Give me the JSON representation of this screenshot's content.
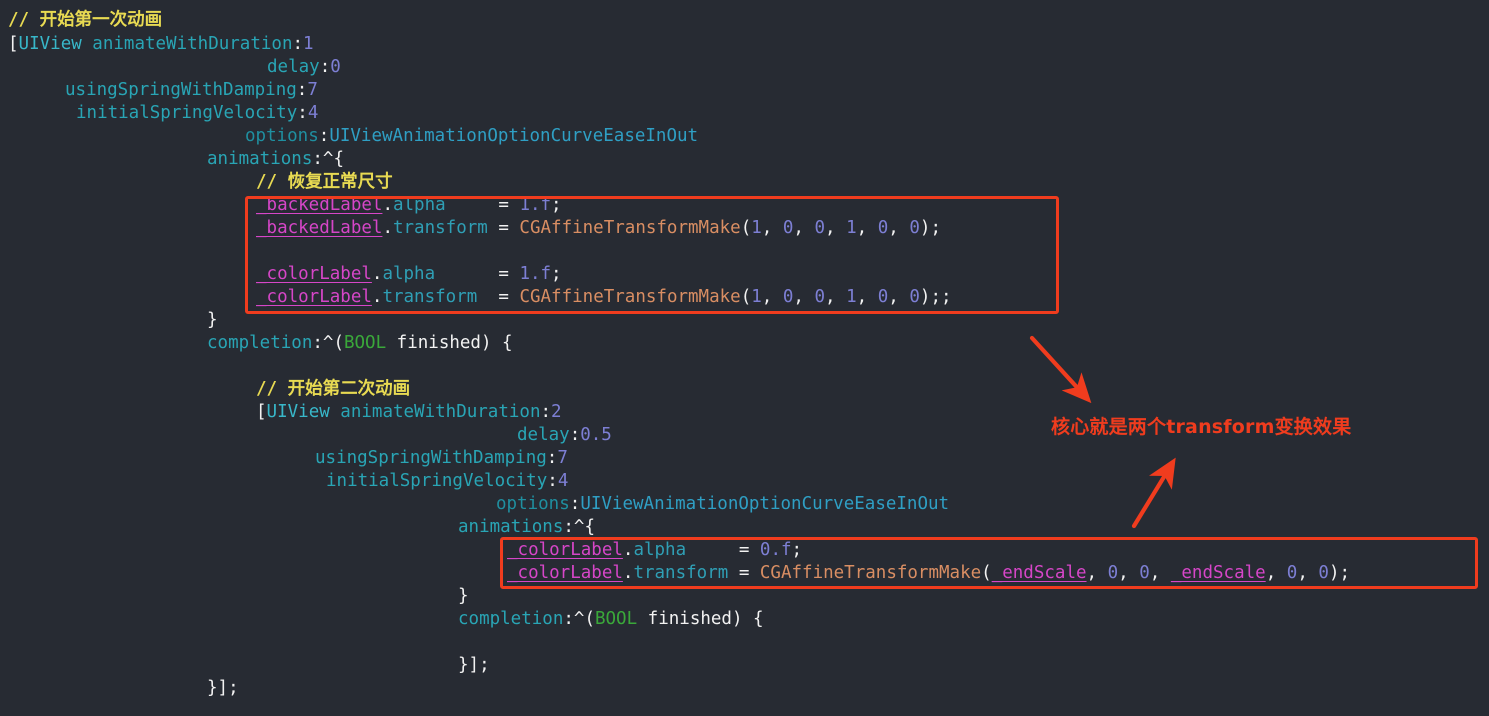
{
  "editor": {
    "background_color": "#272b33",
    "default_text_color": "#f2f2f2",
    "comment_color": "#e8da52",
    "class_color": "#38b7c9",
    "selector_color": "#29a5b5",
    "number_color": "#7d7fd4",
    "enum_color": "#2f9fc4",
    "ivar_color": "#d646c8",
    "property_color": "#2f9fb5",
    "function_color": "#d98e63",
    "type_color": "#3aa83a",
    "annotation_color": "#f03c1e",
    "language": "Objective-C"
  },
  "code": {
    "line_01_comment": "// 开始第一次动画",
    "line_02_bracket": "[",
    "line_02_class": "UIView",
    "line_02_selector": " animateWithDuration",
    "line_02_colon": ":",
    "line_02_value": "1",
    "line_03_selector": "delay",
    "line_03_colon": ":",
    "line_03_value": "0",
    "line_04_selector": "usingSpringWithDamping",
    "line_04_colon": ":",
    "line_04_value": "7",
    "line_05_selector": "initialSpringVelocity",
    "line_05_colon": ":",
    "line_05_value": "4",
    "line_06_selector": "options",
    "line_06_colon": ":",
    "line_06_value": "UIViewAnimationOptionCurveEaseInOut",
    "line_07_selector": "animations",
    "line_07_colon": ":",
    "line_07_block": "^{",
    "line_08_comment": "// 恢复正常尺寸",
    "line_09_ivar": "_backedLabel",
    "line_09_dot": ".",
    "line_09_prop": "alpha",
    "line_09_assign": "     = ",
    "line_09_value": "1.f",
    "line_09_semi": ";",
    "line_10_ivar": "_backedLabel",
    "line_10_dot": ".",
    "line_10_prop": "transform",
    "line_10_assign": " = ",
    "line_10_func": "CGAffineTransformMake",
    "line_10_args_open": "(",
    "line_10_a1": "1",
    "line_10_c1": ", ",
    "line_10_a2": "0",
    "line_10_c2": ", ",
    "line_10_a3": "0",
    "line_10_c3": ", ",
    "line_10_a4": "1",
    "line_10_c4": ", ",
    "line_10_a5": "0",
    "line_10_c5": ", ",
    "line_10_a6": "0",
    "line_10_close": ");",
    "line_12_ivar": "_colorLabel",
    "line_12_dot": ".",
    "line_12_prop": "alpha",
    "line_12_assign": "      = ",
    "line_12_value": "1.f",
    "line_12_semi": ";",
    "line_13_ivar": "_colorLabel",
    "line_13_dot": ".",
    "line_13_prop": "transform",
    "line_13_assign": "  = ",
    "line_13_func": "CGAffineTransformMake",
    "line_13_args_open": "(",
    "line_13_a1": "1",
    "line_13_c1": ", ",
    "line_13_a2": "0",
    "line_13_c2": ", ",
    "line_13_a3": "0",
    "line_13_c3": ", ",
    "line_13_a4": "1",
    "line_13_c4": ", ",
    "line_13_a5": "0",
    "line_13_c5": ", ",
    "line_13_a6": "0",
    "line_13_close": ");;",
    "line_14_brace": "}",
    "line_15_selector": "completion",
    "line_15_colon": ":",
    "line_15_block_open": "^(",
    "line_15_type": "BOOL",
    "line_15_param": " finished) {",
    "line_17_comment": "// 开始第二次动画",
    "line_18_bracket": "[",
    "line_18_class": "UIView",
    "line_18_selector": " animateWithDuration",
    "line_18_colon": ":",
    "line_18_value": "2",
    "line_19_selector": "delay",
    "line_19_colon": ":",
    "line_19_value": "0.5",
    "line_20_selector": "usingSpringWithDamping",
    "line_20_colon": ":",
    "line_20_value": "7",
    "line_21_selector": "initialSpringVelocity",
    "line_21_colon": ":",
    "line_21_value": "4",
    "line_22_selector": "options",
    "line_22_colon": ":",
    "line_22_value": "UIViewAnimationOptionCurveEaseInOut",
    "line_23_selector": "animations",
    "line_23_colon": ":",
    "line_23_block": "^{",
    "line_24_ivar": "_colorLabel",
    "line_24_dot": ".",
    "line_24_prop": "alpha",
    "line_24_assign": "     = ",
    "line_24_value": "0.f",
    "line_24_semi": ";",
    "line_25_ivar": "_colorLabel",
    "line_25_dot": ".",
    "line_25_prop": "transform",
    "line_25_assign": " = ",
    "line_25_func": "CGAffineTransformMake",
    "line_25_args_open": "(",
    "line_25_a1": "_endScale",
    "line_25_c1": ", ",
    "line_25_a2": "0",
    "line_25_c2": ", ",
    "line_25_a3": "0",
    "line_25_c3": ", ",
    "line_25_a4": "_endScale",
    "line_25_c4": ", ",
    "line_25_a5": "0",
    "line_25_c5": ", ",
    "line_25_a6": "0",
    "line_25_close": ");",
    "line_26_brace": "}",
    "line_27_selector": "completion",
    "line_27_colon": ":",
    "line_27_block_open": "^(",
    "line_27_type": "BOOL",
    "line_27_param": " finished) {",
    "line_29_close": "}];",
    "line_30_close": "}];"
  },
  "annotations": {
    "note_text": "核心就是两个transform变换效果",
    "box_1_label": "highlight-box-first-animation-transforms",
    "box_2_label": "highlight-box-second-animation-transforms",
    "arrow_1_label": "arrow-pointing-up-left-to-first-box",
    "arrow_2_label": "arrow-pointing-down-right-to-second-box"
  }
}
